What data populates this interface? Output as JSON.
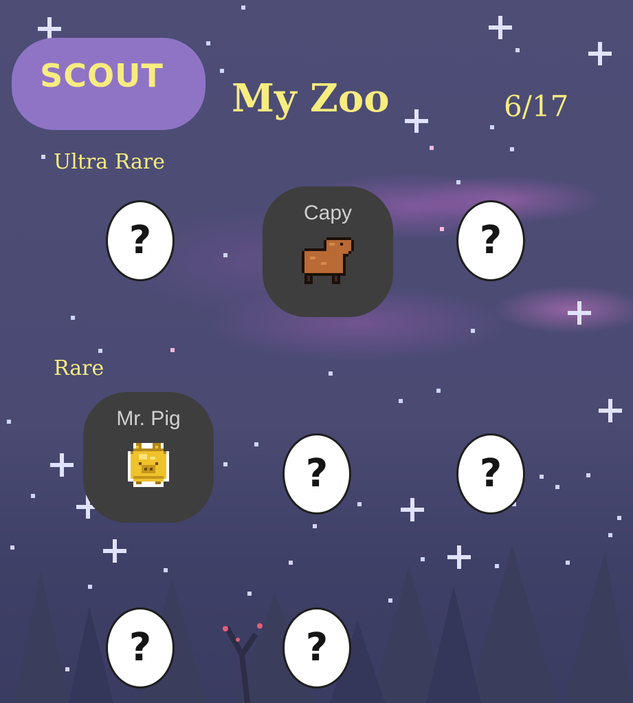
{
  "header": {
    "scout_label": "SCOUT",
    "title": "My Zoo",
    "count": "6/17"
  },
  "sections": {
    "ultra_rare": {
      "label": "Ultra Rare",
      "slots": [
        {
          "state": "unknown",
          "symbol": "?"
        },
        {
          "state": "collected",
          "name": "Capy",
          "icon": "capybara-icon"
        },
        {
          "state": "unknown",
          "symbol": "?"
        }
      ]
    },
    "rare": {
      "label": "Rare",
      "slots": [
        {
          "state": "collected",
          "name": "Mr. Pig",
          "icon": "golden-pig-icon"
        },
        {
          "state": "unknown",
          "symbol": "?"
        },
        {
          "state": "unknown",
          "symbol": "?"
        },
        {
          "state": "unknown",
          "symbol": "?"
        },
        {
          "state": "unknown",
          "symbol": "?"
        }
      ]
    }
  },
  "colors": {
    "accent_text": "#f7ec7e",
    "scout_button": "#8f74c6",
    "card_bg": "#3e3e3e",
    "sky": "#4a4a72"
  }
}
